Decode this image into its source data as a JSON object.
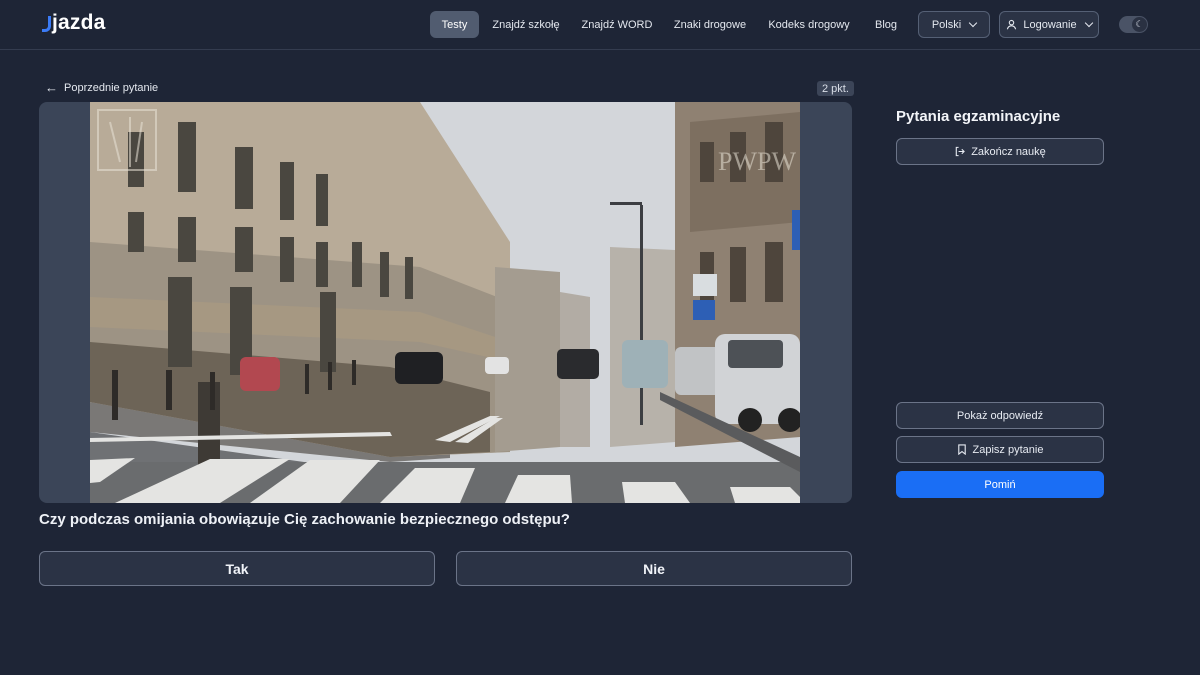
{
  "header": {
    "logo": "jazda",
    "nav": [
      {
        "label": "Testy",
        "active": true
      },
      {
        "label": "Znajdź szkołę"
      },
      {
        "label": "Znajdź WORD"
      },
      {
        "label": "Znaki drogowe"
      },
      {
        "label": "Kodeks drogowy"
      },
      {
        "label": "Blog"
      }
    ],
    "language": "Polski",
    "login": "Logowanie",
    "theme_toggle_icon": "moon-icon"
  },
  "question_meta": {
    "back_label": "Poprzednie pytanie",
    "points": "2 pkt."
  },
  "media": {
    "watermark": "PWPW"
  },
  "question": {
    "text": "Czy podczas omijania obowiązuje Cię zachowanie bezpiecznego odstępu?",
    "answers": [
      "Tak",
      "Nie"
    ]
  },
  "sidebar": {
    "title": "Pytania egzaminacyjne",
    "end_label": "Zakończ naukę",
    "show_answer_label": "Pokaż odpowiedź",
    "save_label": "Zapisz pytanie",
    "skip_label": "Pomiń"
  },
  "colors": {
    "background": "#1e2536",
    "accent": "#1a6ef5",
    "logo_accent": "#3b7bf6"
  }
}
